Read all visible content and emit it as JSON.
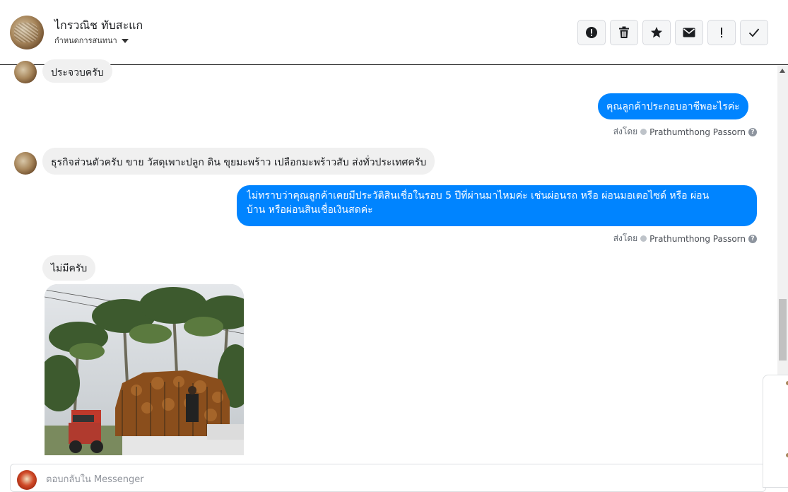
{
  "header": {
    "contact_name": "ไกรวณิช ทับสะแก",
    "settings_label": "กำหนดการสนทนา",
    "toolbar": [
      {
        "icon": "alert-circle-icon",
        "name": "mark-spam-button"
      },
      {
        "icon": "trash-icon",
        "name": "delete-button"
      },
      {
        "icon": "star-icon",
        "name": "star-button"
      },
      {
        "icon": "envelope-icon",
        "name": "mark-unread-button"
      },
      {
        "icon": "exclamation-icon",
        "name": "follow-up-button"
      },
      {
        "icon": "check-icon",
        "name": "mark-done-button"
      }
    ]
  },
  "messages": {
    "m1": {
      "text": "ประจวบครับ"
    },
    "m2": {
      "text": "คุณลูกค้าประกอบอาชีพอะไรค่ะ",
      "sent_prefix": "ส่งโดย",
      "agent": "Prathumthong Passorn"
    },
    "m3": {
      "text": "ธุรกิจส่วนตัวครับ ขาย วัสดุเพาะปลูก ดิน ขุยมะพร้าว เปลือกมะพร้าวสับ ส่งทั่วประเทศครับ"
    },
    "m4": {
      "line1": "ไม่ทราบว่าคุณลูกค้าเคยมีประวัติสินเชื่อในรอบ 5 ปีที่ผ่านมาไหมค่ะ เช่นผ่อนรถ หรือ ผ่อนมอเตอไซด์ หรือ ผ่อน",
      "line2": "บ้าน หรือผ่อนสินเชื่อเงินสดค่ะ",
      "sent_prefix": "ส่งโดย",
      "agent": "Prathumthong Passorn"
    },
    "m5": {
      "text": "ไม่มีครับ"
    }
  },
  "reply": {
    "placeholder": "ตอบกลับใน Messenger"
  },
  "colors": {
    "outgoing_bubble": "#0084ff",
    "incoming_bubble": "#f0f0f0"
  }
}
